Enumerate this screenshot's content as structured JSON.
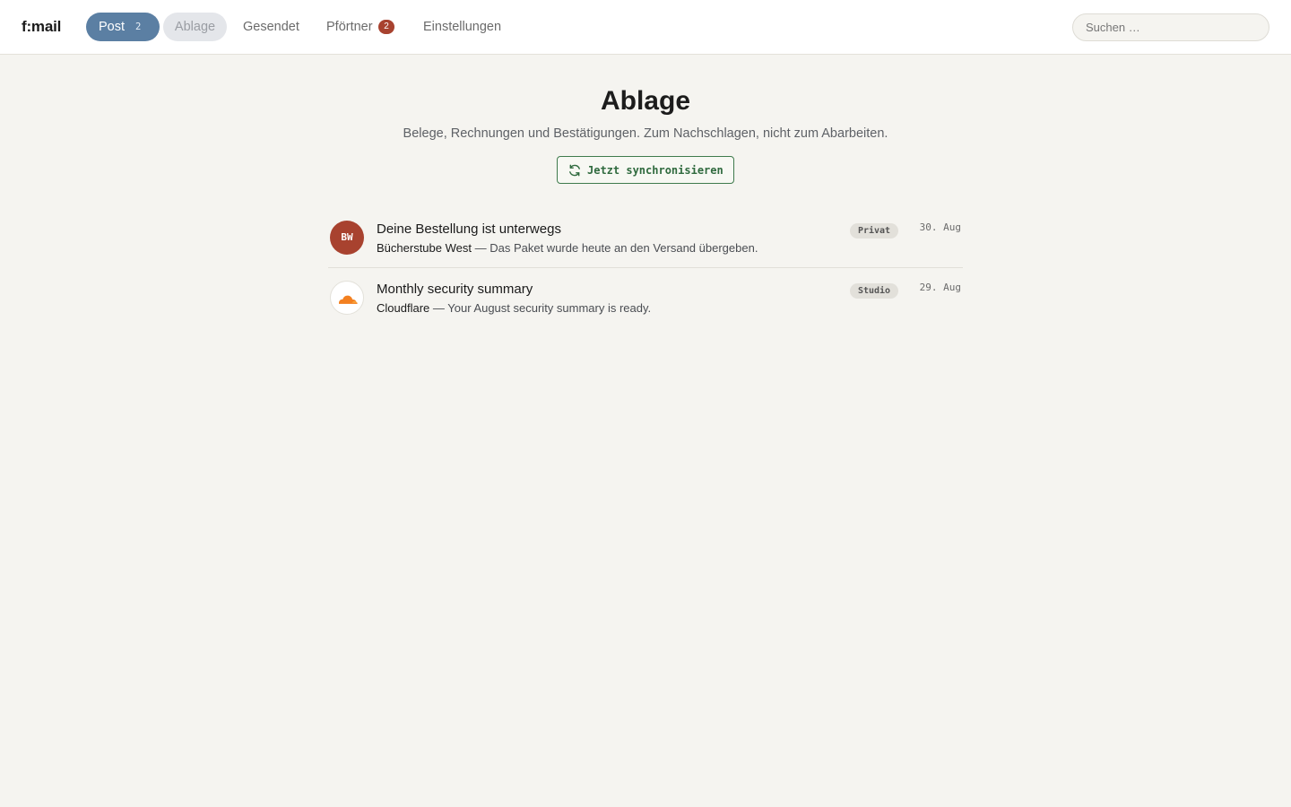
{
  "app": {
    "logo": "f:mail"
  },
  "nav": {
    "post": {
      "label": "Post",
      "count": "2"
    },
    "ablage": {
      "label": "Ablage"
    },
    "gesendet": {
      "label": "Gesendet"
    },
    "pfoertner": {
      "label": "Pförtner",
      "count": "2"
    },
    "einstellungen": {
      "label": "Einstellungen"
    }
  },
  "search": {
    "placeholder": "Suchen …",
    "value": ""
  },
  "page": {
    "title": "Ablage",
    "subtitle": "Belege, Rechnungen und Bestätigungen. Zum Nachschlagen, nicht zum Abarbeiten.",
    "sync_label": "Jetzt synchronisieren",
    "sync_icon": "refresh-icon"
  },
  "messages": [
    {
      "avatar": "BW",
      "avatar_color": "#a8422f",
      "subject": "Deine Bestellung ist unterwegs",
      "sender": "Bücherstube West",
      "separator": " — ",
      "snippet": "Das Paket wurde heute an den Versand übergeben.",
      "tag": "Privat",
      "date": "30. Aug"
    },
    {
      "avatar_icon": "cloudflare-cloud-icon",
      "avatar_color": "#f38020",
      "subject": "Monthly security summary",
      "sender": "Cloudflare",
      "separator": " — ",
      "snippet": "Your August security summary is ready.",
      "tag": "Studio",
      "date": "29. Aug"
    }
  ],
  "colors": {
    "background": "#f5f4f0",
    "accent_blue": "#5b7fa3",
    "badge_red": "#a8422f",
    "sync_green": "#2f6a3e"
  }
}
